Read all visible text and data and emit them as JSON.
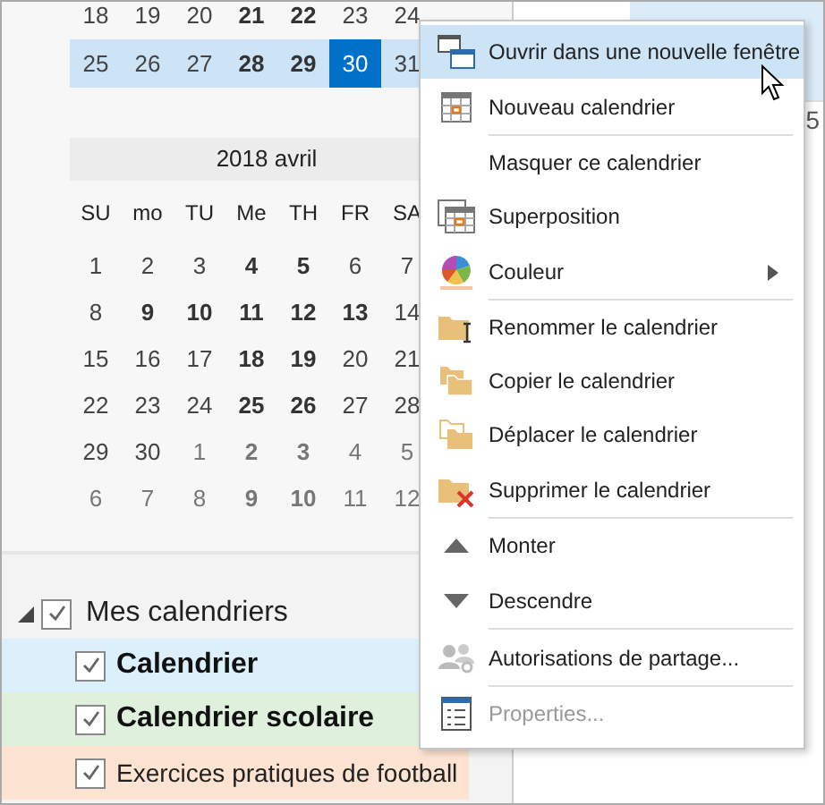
{
  "mini_calendar": {
    "top_weeks": [
      {
        "selected": false,
        "days": [
          {
            "label": "18",
            "bold": false,
            "today": false
          },
          {
            "label": "19",
            "bold": false,
            "today": false
          },
          {
            "label": "20",
            "bold": false,
            "today": false
          },
          {
            "label": "21",
            "bold": true,
            "today": false
          },
          {
            "label": "22",
            "bold": true,
            "today": false
          },
          {
            "label": "23",
            "bold": false,
            "today": false
          },
          {
            "label": "24",
            "bold": false,
            "today": false
          }
        ]
      },
      {
        "selected": true,
        "days": [
          {
            "label": "25",
            "bold": false,
            "today": false
          },
          {
            "label": "26",
            "bold": false,
            "today": false
          },
          {
            "label": "27",
            "bold": false,
            "today": false
          },
          {
            "label": "28",
            "bold": true,
            "today": false
          },
          {
            "label": "29",
            "bold": true,
            "today": false
          },
          {
            "label": "30",
            "bold": false,
            "today": true
          },
          {
            "label": "31",
            "bold": false,
            "today": false
          }
        ]
      }
    ],
    "month_title": "2018 avril",
    "weekdays": [
      "SU",
      "mo",
      "TU",
      "Me",
      "TH",
      "FR",
      "SA"
    ],
    "weeks": [
      [
        {
          "label": "1",
          "bold": false,
          "other": false
        },
        {
          "label": "2",
          "bold": false,
          "other": false
        },
        {
          "label": "3",
          "bold": false,
          "other": false
        },
        {
          "label": "4",
          "bold": true,
          "other": false
        },
        {
          "label": "5",
          "bold": true,
          "other": false
        },
        {
          "label": "6",
          "bold": false,
          "other": false
        },
        {
          "label": "7",
          "bold": false,
          "other": false
        }
      ],
      [
        {
          "label": "8",
          "bold": false,
          "other": false
        },
        {
          "label": "9",
          "bold": true,
          "other": false
        },
        {
          "label": "10",
          "bold": true,
          "other": false
        },
        {
          "label": "11",
          "bold": true,
          "other": false
        },
        {
          "label": "12",
          "bold": true,
          "other": false
        },
        {
          "label": "13",
          "bold": true,
          "other": false
        },
        {
          "label": "14",
          "bold": false,
          "other": false
        }
      ],
      [
        {
          "label": "15",
          "bold": false,
          "other": false
        },
        {
          "label": "16",
          "bold": false,
          "other": false
        },
        {
          "label": "17",
          "bold": false,
          "other": false
        },
        {
          "label": "18",
          "bold": true,
          "other": false
        },
        {
          "label": "19",
          "bold": true,
          "other": false
        },
        {
          "label": "20",
          "bold": false,
          "other": false
        },
        {
          "label": "21",
          "bold": false,
          "other": false
        }
      ],
      [
        {
          "label": "22",
          "bold": false,
          "other": false
        },
        {
          "label": "23",
          "bold": false,
          "other": false
        },
        {
          "label": "24",
          "bold": false,
          "other": false
        },
        {
          "label": "25",
          "bold": true,
          "other": false
        },
        {
          "label": "26",
          "bold": true,
          "other": false
        },
        {
          "label": "27",
          "bold": false,
          "other": false
        },
        {
          "label": "28",
          "bold": false,
          "other": false
        }
      ],
      [
        {
          "label": "29",
          "bold": false,
          "other": false
        },
        {
          "label": "30",
          "bold": false,
          "other": false
        },
        {
          "label": "1",
          "bold": false,
          "other": true
        },
        {
          "label": "2",
          "bold": true,
          "other": true
        },
        {
          "label": "3",
          "bold": true,
          "other": true
        },
        {
          "label": "4",
          "bold": false,
          "other": true
        },
        {
          "label": "5",
          "bold": false,
          "other": true
        }
      ],
      [
        {
          "label": "6",
          "bold": false,
          "other": true
        },
        {
          "label": "7",
          "bold": false,
          "other": true
        },
        {
          "label": "8",
          "bold": false,
          "other": true
        },
        {
          "label": "9",
          "bold": true,
          "other": true
        },
        {
          "label": "10",
          "bold": true,
          "other": true
        },
        {
          "label": "11",
          "bold": false,
          "other": true
        },
        {
          "label": "12",
          "bold": false,
          "other": true
        }
      ]
    ]
  },
  "calendar_group": {
    "label": "Mes calendriers",
    "expanded": true,
    "checked": true,
    "items": [
      {
        "label": "Calendrier",
        "checked": true,
        "bold": true,
        "color": "#dcf0fb"
      },
      {
        "label": "Calendrier scolaire",
        "checked": true,
        "bold": true,
        "color": "#dff0dd"
      },
      {
        "label": "Exercices pratiques de football",
        "checked": true,
        "bold": false,
        "color": "#fde4d2"
      }
    ]
  },
  "calendar_view": {
    "cell_text": "5"
  },
  "context_menu": [
    {
      "label": "Ouvrir dans une nouvelle fenêtre",
      "selected": true,
      "disabled": false,
      "submenu": false,
      "separator_after": false
    },
    {
      "label": "Nouveau calendrier",
      "selected": false,
      "disabled": false,
      "submenu": false,
      "separator_after": true
    },
    {
      "label": "Masquer ce calendrier",
      "selected": false,
      "disabled": false,
      "submenu": false,
      "separator_after": false
    },
    {
      "label": "Superposition",
      "selected": false,
      "disabled": false,
      "submenu": false,
      "separator_after": false
    },
    {
      "label": "Couleur",
      "selected": false,
      "disabled": false,
      "submenu": true,
      "separator_after": true
    },
    {
      "label": "Renommer le calendrier",
      "selected": false,
      "disabled": false,
      "submenu": false,
      "separator_after": false
    },
    {
      "label": "Copier le calendrier",
      "selected": false,
      "disabled": false,
      "submenu": false,
      "separator_after": false
    },
    {
      "label": "Déplacer le calendrier",
      "selected": false,
      "disabled": false,
      "submenu": false,
      "separator_after": false
    },
    {
      "label": "Supprimer le calendrier",
      "selected": false,
      "disabled": false,
      "submenu": false,
      "separator_after": true
    },
    {
      "label": "Monter",
      "selected": false,
      "disabled": false,
      "submenu": false,
      "separator_after": false
    },
    {
      "label": "Descendre",
      "selected": false,
      "disabled": false,
      "submenu": false,
      "separator_after": true
    },
    {
      "label": "Autorisations de partage...",
      "selected": false,
      "disabled": false,
      "submenu": false,
      "separator_after": true
    },
    {
      "label": "Properties...",
      "selected": false,
      "disabled": true,
      "submenu": false,
      "separator_after": false
    }
  ]
}
